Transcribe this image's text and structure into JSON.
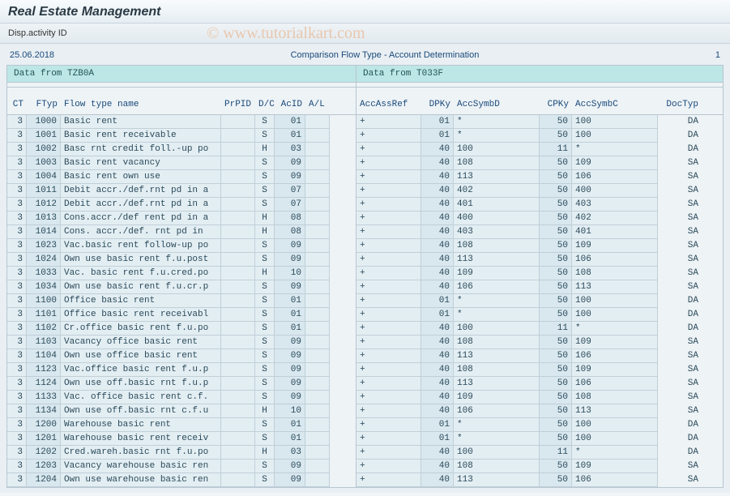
{
  "app": {
    "title": "Real Estate Management",
    "subtitle": "Disp.activity ID"
  },
  "watermark": "© www.tutorialkart.com",
  "report": {
    "date": "25.06.2018",
    "title": "Comparison Flow Type - Account Determination",
    "page": "1"
  },
  "panels": {
    "left_title": "Data from TZB0A",
    "right_title": "Data from T033F"
  },
  "headers": {
    "left": {
      "ct": "CT",
      "ftyp": "FTyp",
      "name": "Flow type name",
      "prpid": "PrPID",
      "dc": "D/C",
      "acid": "AcID",
      "al": "A/L"
    },
    "right": {
      "accref": "AccAssRef",
      "dpky": "DPKy",
      "accd": "AccSymbD",
      "cpky": "CPKy",
      "accc": "AccSymbC",
      "doctyp": "DocTyp"
    }
  },
  "rows": [
    {
      "ct": "3",
      "ftyp": "1000",
      "name": "Basic rent",
      "prpid": "",
      "dc": "S",
      "acid": "01",
      "al": "",
      "accref": "+",
      "dpky": "01",
      "accd": "*",
      "cpky": "50",
      "accc": "100",
      "doctyp": "DA"
    },
    {
      "ct": "3",
      "ftyp": "1001",
      "name": "Basic rent receivable",
      "prpid": "",
      "dc": "S",
      "acid": "01",
      "al": "",
      "accref": "+",
      "dpky": "01",
      "accd": "*",
      "cpky": "50",
      "accc": "100",
      "doctyp": "DA"
    },
    {
      "ct": "3",
      "ftyp": "1002",
      "name": "Basc rnt credit foll.-up po",
      "prpid": "",
      "dc": "H",
      "acid": "03",
      "al": "",
      "accref": "+",
      "dpky": "40",
      "accd": "100",
      "cpky": "11",
      "accc": "*",
      "doctyp": "DA"
    },
    {
      "ct": "3",
      "ftyp": "1003",
      "name": "Basic rent vacancy",
      "prpid": "",
      "dc": "S",
      "acid": "09",
      "al": "",
      "accref": "+",
      "dpky": "40",
      "accd": "108",
      "cpky": "50",
      "accc": "109",
      "doctyp": "SA"
    },
    {
      "ct": "3",
      "ftyp": "1004",
      "name": "Basic rent own use",
      "prpid": "",
      "dc": "S",
      "acid": "09",
      "al": "",
      "accref": "+",
      "dpky": "40",
      "accd": "113",
      "cpky": "50",
      "accc": "106",
      "doctyp": "SA"
    },
    {
      "ct": "3",
      "ftyp": "1011",
      "name": "Debit accr./def.rnt pd in a",
      "prpid": "",
      "dc": "S",
      "acid": "07",
      "al": "",
      "accref": "+",
      "dpky": "40",
      "accd": "402",
      "cpky": "50",
      "accc": "400",
      "doctyp": "SA"
    },
    {
      "ct": "3",
      "ftyp": "1012",
      "name": "Debit accr./def.rnt pd in a",
      "prpid": "",
      "dc": "S",
      "acid": "07",
      "al": "",
      "accref": "+",
      "dpky": "40",
      "accd": "401",
      "cpky": "50",
      "accc": "403",
      "doctyp": "SA"
    },
    {
      "ct": "3",
      "ftyp": "1013",
      "name": "Cons.accr./def rent pd in a",
      "prpid": "",
      "dc": "H",
      "acid": "08",
      "al": "",
      "accref": "+",
      "dpky": "40",
      "accd": "400",
      "cpky": "50",
      "accc": "402",
      "doctyp": "SA"
    },
    {
      "ct": "3",
      "ftyp": "1014",
      "name": "Cons. accr./def. rnt pd in",
      "prpid": "",
      "dc": "H",
      "acid": "08",
      "al": "",
      "accref": "+",
      "dpky": "40",
      "accd": "403",
      "cpky": "50",
      "accc": "401",
      "doctyp": "SA"
    },
    {
      "ct": "3",
      "ftyp": "1023",
      "name": "Vac.basic rent follow-up po",
      "prpid": "",
      "dc": "S",
      "acid": "09",
      "al": "",
      "accref": "+",
      "dpky": "40",
      "accd": "108",
      "cpky": "50",
      "accc": "109",
      "doctyp": "SA"
    },
    {
      "ct": "3",
      "ftyp": "1024",
      "name": "Own use basic rent f.u.post",
      "prpid": "",
      "dc": "S",
      "acid": "09",
      "al": "",
      "accref": "+",
      "dpky": "40",
      "accd": "113",
      "cpky": "50",
      "accc": "106",
      "doctyp": "SA"
    },
    {
      "ct": "3",
      "ftyp": "1033",
      "name": "Vac. basic rent f.u.cred.po",
      "prpid": "",
      "dc": "H",
      "acid": "10",
      "al": "",
      "accref": "+",
      "dpky": "40",
      "accd": "109",
      "cpky": "50",
      "accc": "108",
      "doctyp": "SA"
    },
    {
      "ct": "3",
      "ftyp": "1034",
      "name": "Own use basic rent f.u.cr.p",
      "prpid": "",
      "dc": "S",
      "acid": "09",
      "al": "",
      "accref": "+",
      "dpky": "40",
      "accd": "106",
      "cpky": "50",
      "accc": "113",
      "doctyp": "SA"
    },
    {
      "ct": "3",
      "ftyp": "1100",
      "name": "Office basic rent",
      "prpid": "",
      "dc": "S",
      "acid": "01",
      "al": "",
      "accref": "+",
      "dpky": "01",
      "accd": "*",
      "cpky": "50",
      "accc": "100",
      "doctyp": "DA"
    },
    {
      "ct": "3",
      "ftyp": "1101",
      "name": "Office basic rent receivabl",
      "prpid": "",
      "dc": "S",
      "acid": "01",
      "al": "",
      "accref": "+",
      "dpky": "01",
      "accd": "*",
      "cpky": "50",
      "accc": "100",
      "doctyp": "DA"
    },
    {
      "ct": "3",
      "ftyp": "1102",
      "name": "Cr.office basic rent f.u.po",
      "prpid": "",
      "dc": "S",
      "acid": "01",
      "al": "",
      "accref": "+",
      "dpky": "40",
      "accd": "100",
      "cpky": "11",
      "accc": "*",
      "doctyp": "DA"
    },
    {
      "ct": "3",
      "ftyp": "1103",
      "name": "Vacancy office basic rent",
      "prpid": "",
      "dc": "S",
      "acid": "09",
      "al": "",
      "accref": "+",
      "dpky": "40",
      "accd": "108",
      "cpky": "50",
      "accc": "109",
      "doctyp": "SA"
    },
    {
      "ct": "3",
      "ftyp": "1104",
      "name": "Own use office basic rent",
      "prpid": "",
      "dc": "S",
      "acid": "09",
      "al": "",
      "accref": "+",
      "dpky": "40",
      "accd": "113",
      "cpky": "50",
      "accc": "106",
      "doctyp": "SA"
    },
    {
      "ct": "3",
      "ftyp": "1123",
      "name": "Vac.office basic rent f.u.p",
      "prpid": "",
      "dc": "S",
      "acid": "09",
      "al": "",
      "accref": "+",
      "dpky": "40",
      "accd": "108",
      "cpky": "50",
      "accc": "109",
      "doctyp": "SA"
    },
    {
      "ct": "3",
      "ftyp": "1124",
      "name": "Own use off.basic rnt f.u.p",
      "prpid": "",
      "dc": "S",
      "acid": "09",
      "al": "",
      "accref": "+",
      "dpky": "40",
      "accd": "113",
      "cpky": "50",
      "accc": "106",
      "doctyp": "SA"
    },
    {
      "ct": "3",
      "ftyp": "1133",
      "name": "Vac. office basic rent c.f.",
      "prpid": "",
      "dc": "S",
      "acid": "09",
      "al": "",
      "accref": "+",
      "dpky": "40",
      "accd": "109",
      "cpky": "50",
      "accc": "108",
      "doctyp": "SA"
    },
    {
      "ct": "3",
      "ftyp": "1134",
      "name": "Own use off.basic rnt c.f.u",
      "prpid": "",
      "dc": "H",
      "acid": "10",
      "al": "",
      "accref": "+",
      "dpky": "40",
      "accd": "106",
      "cpky": "50",
      "accc": "113",
      "doctyp": "SA"
    },
    {
      "ct": "3",
      "ftyp": "1200",
      "name": "Warehouse basic rent",
      "prpid": "",
      "dc": "S",
      "acid": "01",
      "al": "",
      "accref": "+",
      "dpky": "01",
      "accd": "*",
      "cpky": "50",
      "accc": "100",
      "doctyp": "DA"
    },
    {
      "ct": "3",
      "ftyp": "1201",
      "name": "Warehouse basic rent receiv",
      "prpid": "",
      "dc": "S",
      "acid": "01",
      "al": "",
      "accref": "+",
      "dpky": "01",
      "accd": "*",
      "cpky": "50",
      "accc": "100",
      "doctyp": "DA"
    },
    {
      "ct": "3",
      "ftyp": "1202",
      "name": "Cred.wareh.basic rnt f.u.po",
      "prpid": "",
      "dc": "H",
      "acid": "03",
      "al": "",
      "accref": "+",
      "dpky": "40",
      "accd": "100",
      "cpky": "11",
      "accc": "*",
      "doctyp": "DA"
    },
    {
      "ct": "3",
      "ftyp": "1203",
      "name": "Vacancy warehouse basic ren",
      "prpid": "",
      "dc": "S",
      "acid": "09",
      "al": "",
      "accref": "+",
      "dpky": "40",
      "accd": "108",
      "cpky": "50",
      "accc": "109",
      "doctyp": "SA"
    },
    {
      "ct": "3",
      "ftyp": "1204",
      "name": "Own use warehouse basic ren",
      "prpid": "",
      "dc": "S",
      "acid": "09",
      "al": "",
      "accref": "+",
      "dpky": "40",
      "accd": "113",
      "cpky": "50",
      "accc": "106",
      "doctyp": "SA"
    }
  ]
}
